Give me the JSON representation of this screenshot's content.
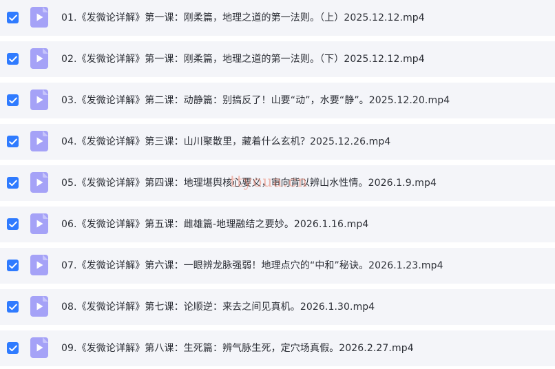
{
  "colors": {
    "row_background": "#f4f5f9",
    "checkbox": "#2f7bff",
    "video_icon": "#9f9cf6",
    "text": "#2c2f36",
    "watermark": "#eb826e"
  },
  "icons": {
    "checkbox": "check-icon",
    "file": "video-file-icon"
  },
  "watermark": "ttyoua.cn",
  "files": [
    {
      "name": "01.《发微论详解》第一课：刚柔篇，地理之道的第一法则。（上）2025.12.12.mp4",
      "checked": true
    },
    {
      "name": "02.《发微论详解》第一课：刚柔篇，地理之道的第一法则。（下）2025.12.12.mp4",
      "checked": true
    },
    {
      "name": "03.《发微论详解》第二课：动静篇：别搞反了！山要“动”，水要“静”。2025.12.20.mp4",
      "checked": true
    },
    {
      "name": "04.《发微论详解》第三课：山川聚散里，藏着什么玄机？2025.12.26.mp4",
      "checked": true
    },
    {
      "name": "05.《发微论详解》第四课：地理堪舆核心要义，审向背以辨山水性情。2026.1.9.mp4",
      "checked": true
    },
    {
      "name": "06.《发微论详解》第五课：雌雄篇-地理融结之要妙。2026.1.16.mp4",
      "checked": true
    },
    {
      "name": "07.《发微论详解》第六课：一眼辨龙脉强弱！地理点穴的“中和”秘诀。2026.1.23.mp4",
      "checked": true
    },
    {
      "name": "08.《发微论详解》第七课：论顺逆：来去之间见真机。2026.1.30.mp4",
      "checked": true
    },
    {
      "name": "09.《发微论详解》第八课：生死篇：辨气脉生死，定穴场真假。2026.2.27.mp4",
      "checked": true
    }
  ]
}
